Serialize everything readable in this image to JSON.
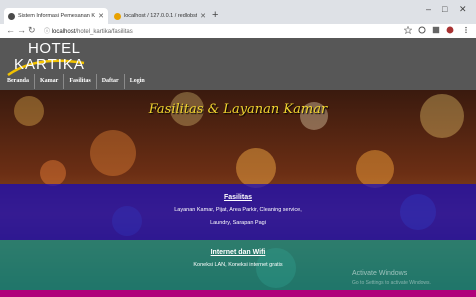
{
  "browser": {
    "tabs": [
      {
        "title": "Sistem Informasi Pemesanan Ka",
        "active": true,
        "favicon_color": "#4a4a4a"
      },
      {
        "title": "localhost / 127.0.0.1 / redlobster",
        "active": false,
        "favicon_color": "#e8a100"
      }
    ],
    "new_tab": "+",
    "window_controls": {
      "minimize": "–",
      "maximize": "□",
      "close": "✕"
    },
    "url_prefix": "ⓘ",
    "url_host": "localhost",
    "url_path": "/hotel_kartika/fasilitas"
  },
  "site": {
    "logo_line1": "HOTEL",
    "logo_line2": "KARTIKA",
    "menu": [
      "Beranda",
      "Kamar",
      "Fasilitas",
      "Daftar",
      "Login"
    ],
    "hero_title": "Fasilitas & Layanan Kamar",
    "sections": [
      {
        "title": "Fasilitas",
        "text": [
          "Layanan Kamar, Pijat, Area Parkir, Cleaning service,",
          "Laundry, Sarapan Pagi"
        ]
      },
      {
        "title": "Internet dan Wifi",
        "text": [
          "Koneksi LAN, Koneksi internet gratis"
        ]
      }
    ]
  },
  "watermark": {
    "line1": "Activate Windows",
    "line2": "Go to Settings to activate Windows."
  },
  "colors": {
    "hero_title": "#f0d430",
    "band_blue": "#140abe",
    "band_teal": "#14968c",
    "header": "#575757"
  }
}
